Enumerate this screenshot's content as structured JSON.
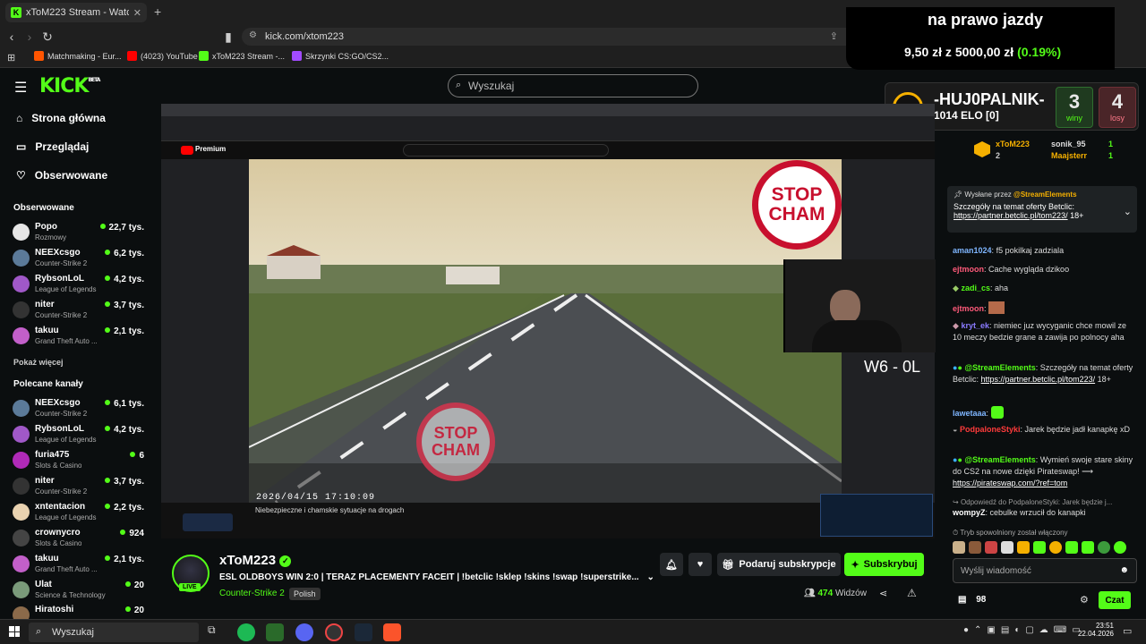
{
  "browser": {
    "tab_title": "xToM223 Stream - Watch Liv",
    "url": "kick.com/xtom223",
    "bookmarks": [
      "Matchmaking - Eur...",
      "(4023) YouTube",
      "xToM223 Stream -...",
      "Skrzynki CS:GO/CS2..."
    ]
  },
  "overlay": {
    "headline": "na prawo jazdy",
    "odds_left": "9,50 zł",
    "odds_mid": "z",
    "odds_goal": "5000,00 zł",
    "odds_pct": "(0.19%)",
    "faceit_level": "4",
    "faceit_name": "-HUJ0PALNIK-",
    "faceit_elo": "1014 ELO [0]",
    "wins": "3",
    "wins_label": "winy",
    "losses": "4",
    "losses_label": "losy"
  },
  "header": {
    "logo": "KICK",
    "logo_sup": "BETA",
    "search_placeholder": "Wyszukaj"
  },
  "sidebar": {
    "nav": [
      {
        "label": "Strona główna",
        "icon": "home-icon"
      },
      {
        "label": "Przeglądaj",
        "icon": "browse-icon"
      },
      {
        "label": "Obserwowane",
        "icon": "heart-icon"
      }
    ],
    "followed_title": "Obserwowane",
    "followed": [
      {
        "name": "Popo",
        "game": "Rozmowy",
        "viewers": "22,7 tys."
      },
      {
        "name": "NEEXcsgo",
        "game": "Counter-Strike 2",
        "viewers": "6,2 tys."
      },
      {
        "name": "RybsonLoL",
        "game": "League of Legends",
        "viewers": "4,2 tys."
      },
      {
        "name": "niter",
        "game": "Counter-Strike 2",
        "viewers": "3,7 tys."
      },
      {
        "name": "takuu",
        "game": "Grand Theft Auto ...",
        "viewers": "2,1 tys."
      }
    ],
    "show_more": "Pokaż więcej",
    "recommended_title": "Polecane kanały",
    "recommended": [
      {
        "name": "NEEXcsgo",
        "game": "Counter-Strike 2",
        "viewers": "6,1 tys."
      },
      {
        "name": "RybsonLoL",
        "game": "League of Legends",
        "viewers": "4,2 tys."
      },
      {
        "name": "furia475",
        "game": "Slots & Casino",
        "viewers": "6"
      },
      {
        "name": "niter",
        "game": "Counter-Strike 2",
        "viewers": "3,7 tys."
      },
      {
        "name": "xntentacion",
        "game": "League of Legends",
        "viewers": "2,2 tys."
      },
      {
        "name": "crownycro",
        "game": "Slots & Casino",
        "viewers": "924"
      },
      {
        "name": "takuu",
        "game": "Grand Theft Auto ...",
        "viewers": "2,1 tys."
      },
      {
        "name": "Ulat",
        "game": "Science & Technology",
        "viewers": "20"
      },
      {
        "name": "Hiratoshi",
        "game": "",
        "viewers": "20"
      }
    ]
  },
  "video": {
    "sign_top": [
      "STOP",
      "CHAM"
    ],
    "sign_bottom": [
      "STOP",
      "CHAM"
    ],
    "score_text": "W6 - 0L",
    "timestamp": "2026/04/15  17:10:09",
    "yt_caption": "Niebezpieczne i chamskie sytuacje na drogach",
    "yt_brand": "Premium"
  },
  "stream": {
    "name": "xToM223",
    "title": "ESL OLDBOYS WIN 2:0 | TERAZ PLACEMENTY FACEIT | !betclic !sklep !skins !swap !superstrike...",
    "game": "Counter-Strike 2",
    "language": "Polish",
    "live": "LIVE",
    "gift_label": "Podaruj subskrypcje",
    "subscribe_label": "Subskrybuj",
    "viewers": "474",
    "viewers_label": "Widzów"
  },
  "chat": {
    "top_users": [
      {
        "name": "xToM223",
        "count": "2"
      },
      {
        "name": "sonik_95",
        "count": "1"
      },
      {
        "name": "Maajsterr",
        "count": "1"
      }
    ],
    "pinned_by": "Wysłane przez",
    "pinned_user": "@StreamElements",
    "pinned_text": "Szczegóły na temat oferty Betclic:",
    "pinned_link": "https://partner.betclic.pl/tom223/",
    "pinned_suffix": "18+",
    "messages": [
      {
        "user": "aman1024",
        "color": "#7fb6ff",
        "text": "f5 pokilkaj zadziala"
      },
      {
        "user": "ejtmoon",
        "color": "#ff5a7a",
        "text": "Cache wygląda dzikoo"
      },
      {
        "user": "zadi_cs",
        "color": "#53fc18",
        "text": "aha"
      },
      {
        "user": "ejtmoon",
        "color": "#ff5a7a",
        "text": ""
      },
      {
        "user": "kryt_ek",
        "color": "#8a7bff",
        "text": "niemiec juz wycyganic chce mowil ze 10 meczy bedzie grane a zawija po polnocy aha"
      },
      {
        "user": "@StreamElements",
        "color": "#53fc18",
        "text": "Szczegóły na temat oferty Betclic:",
        "link": "https://partner.betclic.pl/tom223/",
        "suffix": "18+"
      },
      {
        "user": "lawetaaa",
        "color": "#7fb6ff",
        "text": ""
      },
      {
        "user": "PodpaloneStyki",
        "color": "#ff3b3b",
        "text": "Jarek będzie jadł kanapkę xD"
      },
      {
        "user": "@StreamElements",
        "color": "#53fc18",
        "text": "Wymień swoje stare skiny do CS2 na nowe dzięki Pirateswap! ⟶",
        "link": "https://pirateswap.com/?ref=tom"
      }
    ],
    "reply_to": "Odpowiedź do PodpaloneStyki: Jarek będzie j...",
    "reply_user": "wompyZ",
    "reply_text": "cebulke wrzucił do kanapki",
    "slow_mode": "Tryb spowolniony został włączony",
    "input_placeholder": "Wyślij wiadomość",
    "points": "98",
    "send_label": "Czat"
  },
  "taskbar": {
    "search": "Wyszukaj",
    "time": "23:51",
    "date": "22.04.2026"
  },
  "colors": {
    "kick_green": "#53fc18",
    "bg": "#0b0e0f",
    "faceit_orange": "#f5b000"
  }
}
